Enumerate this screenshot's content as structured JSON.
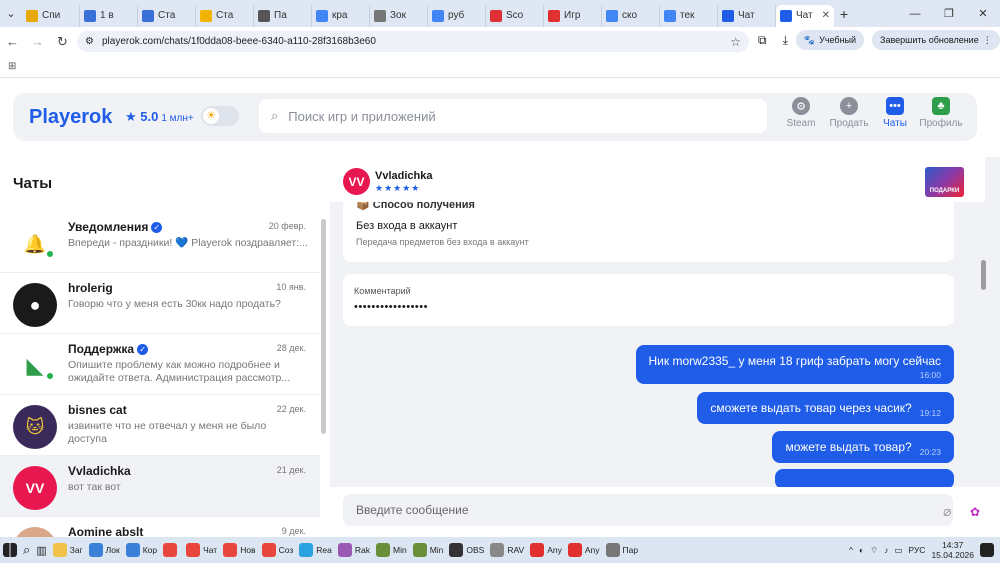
{
  "browser": {
    "tabs": [
      {
        "label": "Спи",
        "color": "#e6a800"
      },
      {
        "label": "1 в",
        "color": "#3a6fd8"
      },
      {
        "label": "Ста",
        "color": "#3a6fd8"
      },
      {
        "label": "Ста",
        "color": "#f0b400"
      },
      {
        "label": "Па",
        "color": "#555555"
      },
      {
        "label": "кра",
        "color": "#4285f4"
      },
      {
        "label": "Зок",
        "color": "#777777"
      },
      {
        "label": "руб",
        "color": "#4285f4"
      },
      {
        "label": "Sco",
        "color": "#e03030"
      },
      {
        "label": "Игр",
        "color": "#e03030"
      },
      {
        "label": "ско",
        "color": "#4285f4"
      },
      {
        "label": "тек",
        "color": "#4285f4"
      },
      {
        "label": "Чат",
        "color": "#1f5de9"
      },
      {
        "label": "Чат",
        "color": "#1f5de9",
        "active": true
      }
    ],
    "url": "playerok.com/chats/1f0dda08-beee-6340-a110-28f3168b3e60",
    "profile_label": "Учебный",
    "update_label": "Завершить обновление"
  },
  "site": {
    "logo": "Playerok",
    "rating": "★ 5.0",
    "rating_count": "1 млн+",
    "search_placeholder": "Поиск игр и приложений",
    "nav": [
      {
        "label": "Steam",
        "icon": "steam-icon"
      },
      {
        "label": "Продать",
        "icon": "plus-icon"
      },
      {
        "label": "Чаты",
        "icon": "chat-icon",
        "active": true
      },
      {
        "label": "Профиль",
        "icon": "profile-icon"
      }
    ]
  },
  "chats": {
    "title": "Чаты",
    "items": [
      {
        "name": "Уведомления",
        "time": "20 февр.",
        "preview": "Впереди - праздники! 💙 Playerok поздравляет:...",
        "verified": true,
        "online": true,
        "avatar": "bell-icon"
      },
      {
        "name": "hrolerig",
        "time": "10 янв.",
        "preview": "Говорю что у меня есть 30кк надо продать?",
        "avatar": "user-icon"
      },
      {
        "name": "Поддержка",
        "time": "28 дек.",
        "preview": "Опишите проблему как можно подробнее и ожидайте ответа. Администрация рассмотр...",
        "verified": true,
        "online": true,
        "avatar": "support-icon"
      },
      {
        "name": "bisnes cat",
        "time": "22 дек.",
        "preview": "извините что не отвечал у меня не было доступа",
        "avatar": "cat-icon"
      },
      {
        "name": "Vvladichka",
        "time": "21 дек.",
        "preview": "вот так вот",
        "selected": true,
        "avatar": "vv-icon"
      },
      {
        "name": "Aomine abslt",
        "time": "9 дек.",
        "preview": "",
        "avatar": "user-photo-icon"
      }
    ]
  },
  "conversation": {
    "name": "Vvladichka",
    "stars": "★★★★★",
    "thumb_text": "ПОДАРКИ",
    "delivery_title": "📦 Способ получения",
    "delivery_value": "Без входа в аккаунт",
    "delivery_sub": "Передача предметов без входа в аккаунт",
    "comment_label": "Комментарий",
    "comment_value": "•••••••••••••••••",
    "messages": [
      {
        "text": "Ник morw2335_ у меня 18 гриф забрать могу сейчас",
        "time": "16:00"
      },
      {
        "text": "сможете выдать товар через часик?",
        "time": "19:12"
      },
      {
        "text": "можете выдать товар?",
        "time": "20:23"
      }
    ],
    "input_placeholder": "Введите сообщение"
  },
  "taskbar": {
    "items": [
      {
        "label": "Заг",
        "color": "#f0c24a"
      },
      {
        "label": "Лок",
        "color": "#3a80d8"
      },
      {
        "label": "Кор",
        "color": "#3a80d8"
      },
      {
        "label": "",
        "color": "#e8453c"
      },
      {
        "label": "Чат",
        "color": "#e8453c"
      },
      {
        "label": "Нов",
        "color": "#e8453c"
      },
      {
        "label": "Соз",
        "color": "#e8453c"
      },
      {
        "label": "Rea",
        "color": "#2aa3e0"
      },
      {
        "label": "Rak",
        "color": "#9b59b6"
      },
      {
        "label": "Min",
        "color": "#6a8f3a"
      },
      {
        "label": "Min",
        "color": "#6a8f3a"
      },
      {
        "label": "OBS",
        "color": "#333333"
      },
      {
        "label": "RAV",
        "color": "#888888"
      },
      {
        "label": "Any",
        "color": "#e03030"
      },
      {
        "label": "Any",
        "color": "#e03030"
      },
      {
        "label": "Пар",
        "color": "#777777"
      }
    ],
    "lang": "РУС",
    "time": "14:37",
    "date": "15.04.2026"
  }
}
